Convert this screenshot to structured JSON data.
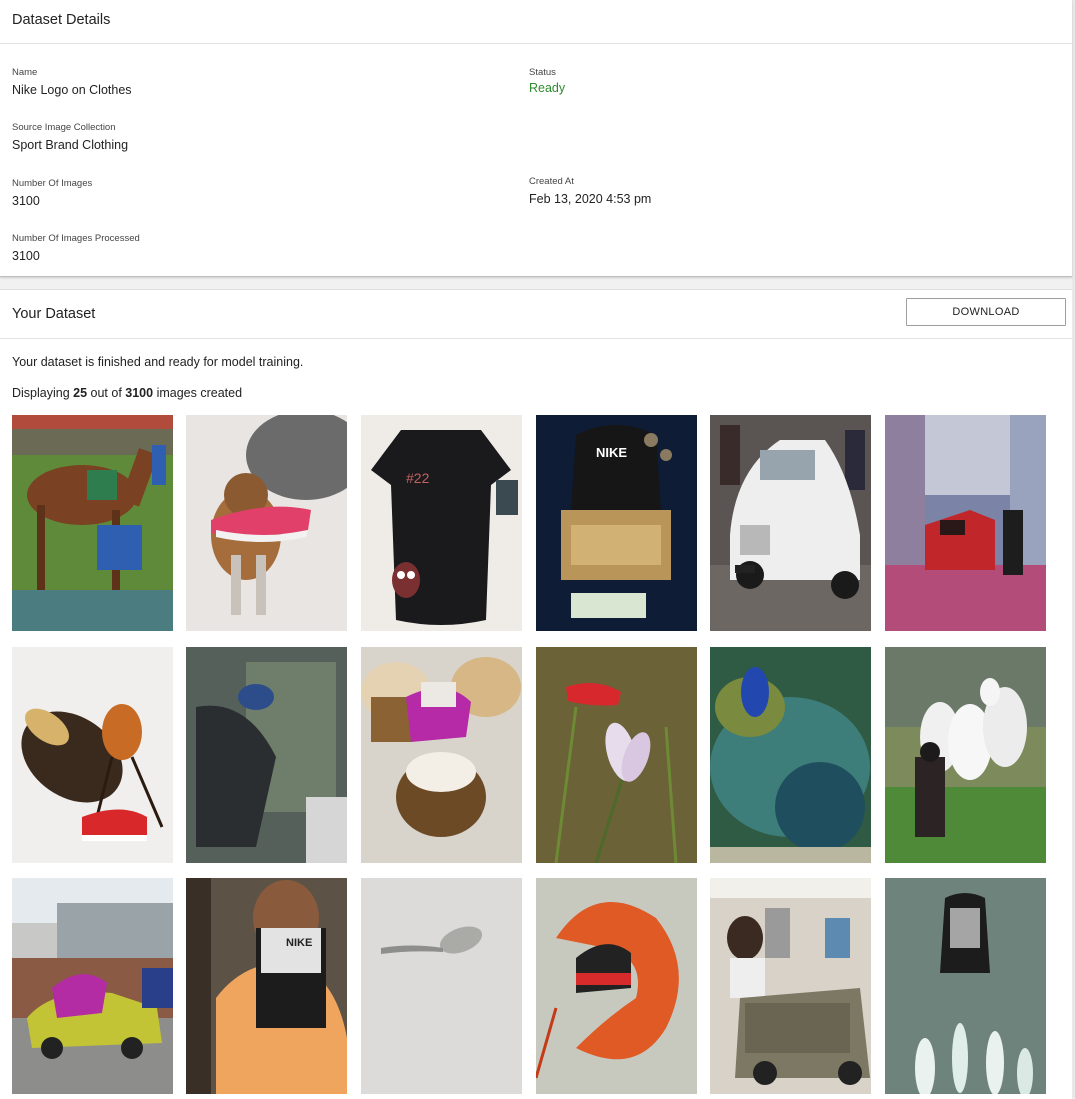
{
  "details": {
    "title": "Dataset Details",
    "fields": {
      "name": {
        "label": "Name",
        "value": "Nike Logo on Clothes"
      },
      "status": {
        "label": "Status",
        "value": "Ready"
      },
      "source": {
        "label": "Source Image Collection",
        "value": "Sport Brand Clothing"
      },
      "num_images": {
        "label": "Number Of Images",
        "value": "3100"
      },
      "created_at": {
        "label": "Created At",
        "value": "Feb 13, 2020 4:53 pm"
      },
      "processed": {
        "label": "Number Of Images Processed",
        "value": "3100"
      }
    }
  },
  "dataset": {
    "title": "Your Dataset",
    "download_label": "DOWNLOAD",
    "finished_msg": "Your dataset is finished and ready for model training.",
    "displaying_prefix": "Displaying ",
    "displaying_count": "25",
    "displaying_mid": " out of ",
    "displaying_total": "3100",
    "displaying_suffix": " images created"
  },
  "thumbnails": [
    {
      "subject": "racehorse with blue sweatshirt"
    },
    {
      "subject": "puppy with pink sneaker"
    },
    {
      "subject": "black t-shirt with owl"
    },
    {
      "subject": "nike hoodie on machine"
    },
    {
      "subject": "white vintage car"
    },
    {
      "subject": "red car with black pants"
    },
    {
      "subject": "hornet with red shoe"
    },
    {
      "subject": "car window with cap"
    },
    {
      "subject": "cupcakes with sneaker"
    },
    {
      "subject": "crocus flower with shoe"
    },
    {
      "subject": "underwater algae"
    },
    {
      "subject": "white dogs with jacket"
    },
    {
      "subject": "yellow car with sneaker"
    },
    {
      "subject": "monk with nike jacket"
    },
    {
      "subject": "spoon"
    },
    {
      "subject": "shrimp with beanie"
    },
    {
      "subject": "woman with land rover"
    },
    {
      "subject": "fountain with jacket"
    }
  ]
}
